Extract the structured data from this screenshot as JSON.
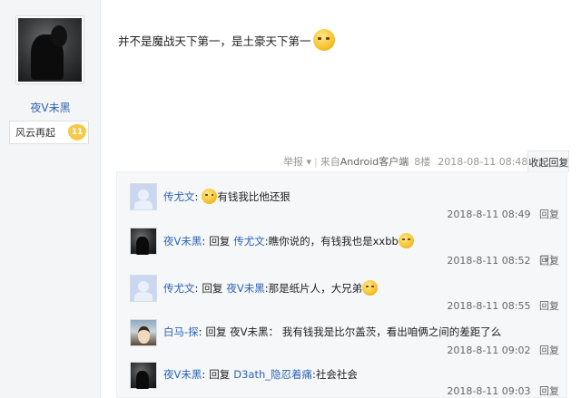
{
  "author": {
    "username": "夜V未黑",
    "rank_label": "风云再起",
    "level": "11"
  },
  "post": {
    "content": "并不是魔战天下第一，是土豪天下第一",
    "emoji_icon": "smiley-face-icon"
  },
  "post_meta": {
    "report": "举报",
    "client_prefix": "来自",
    "client": "Android客户端",
    "floor": "8楼",
    "time": "2018-08-11 08:48",
    "collapse_label": "收起回复"
  },
  "replies": [
    {
      "author": "传尤文",
      "content": "有钱我比他还狠",
      "time": "2018-8-11 08:49",
      "reply_label": "回复",
      "has_emoji": true,
      "colon": ":"
    },
    {
      "author": "夜V未黑",
      "reply_word": "回复",
      "target": "传尤文",
      "content": "瞧你说的，有钱我也是xxbb",
      "time": "2018-8-11 08:52",
      "reply_label": "回复",
      "colon": ":"
    },
    {
      "author": "传尤文",
      "reply_word": "回复",
      "target": "夜V未黑",
      "content": "那是纸片人，大兄弟",
      "time": "2018-8-11 08:55",
      "reply_label": "回复",
      "colon": ":"
    },
    {
      "author": "白马-探",
      "content_full": "回复 夜V未黑： 我有钱我是比尔盖茨，看出咱俩之间的差距了么",
      "time": "2018-8-11 09:02",
      "reply_label": "回复",
      "colon": ":"
    },
    {
      "author": "夜V未黑",
      "reply_word": "回复",
      "target": "D3ath_隐忍着痛",
      "content": "社会社会",
      "time": "2018-8-11 09:03",
      "reply_label": "回复",
      "colon": ":"
    }
  ],
  "colors": {
    "link_blue": "#2d64b3",
    "sidebar_bg": "#f4f5f7",
    "lzl_bg": "#f5f7f9"
  }
}
